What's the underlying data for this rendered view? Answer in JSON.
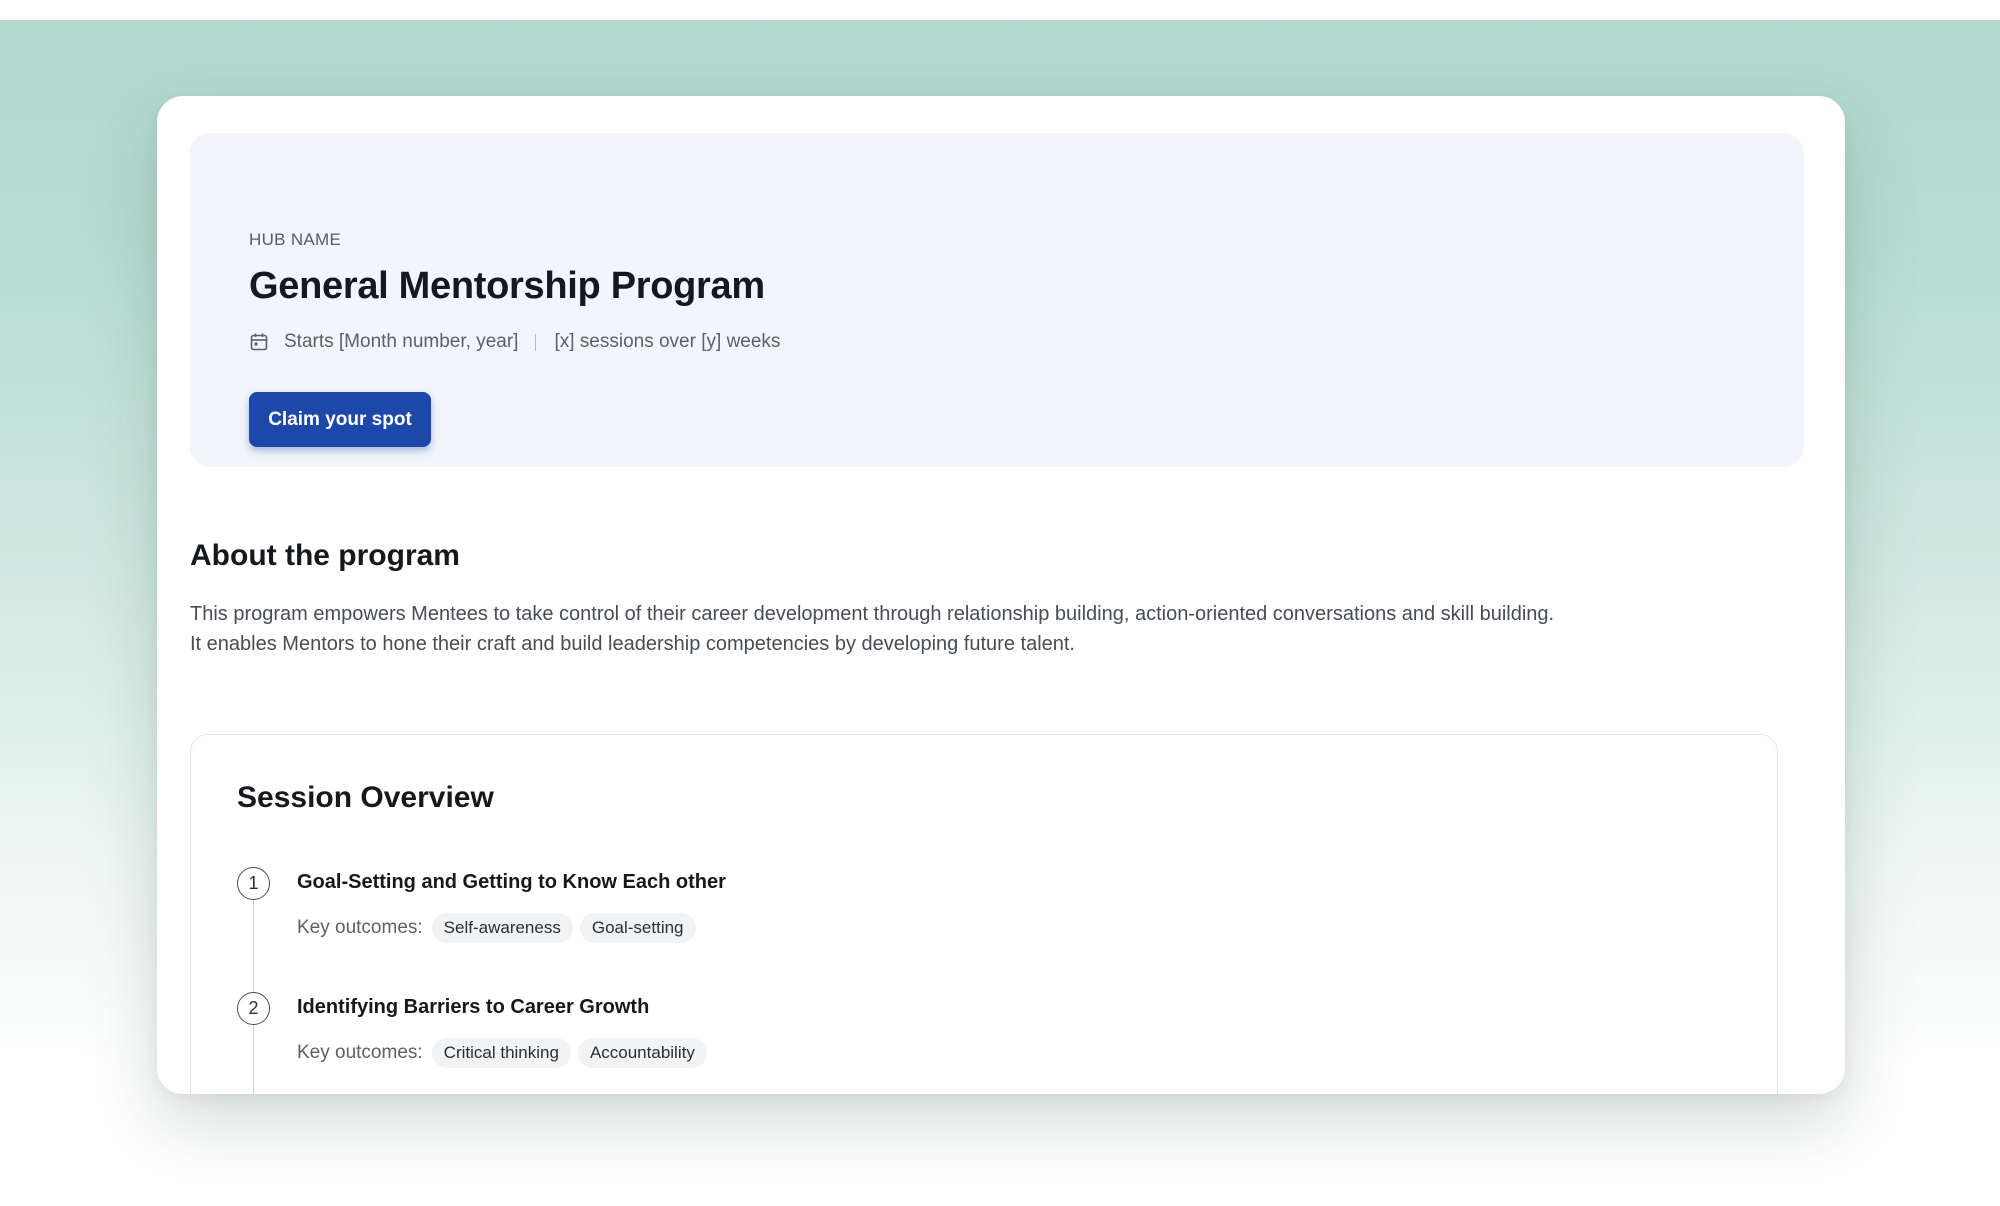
{
  "hub": {
    "label": "HUB NAME",
    "title": "General Mentorship Program",
    "start": "Starts [Month number, year]",
    "sessions_info": "[x] sessions over [y] weeks",
    "cta": "Claim your spot"
  },
  "about": {
    "title": "About the program",
    "text": "This program empowers Mentees to take control of their career development through relationship building, action-oriented conversations and skill building. It enables Mentors to hone their craft and build leadership competencies by developing future talent."
  },
  "overview": {
    "title": "Session Overview",
    "outcomes_label": "Key outcomes:",
    "sessions": [
      {
        "number": "1",
        "title": "Goal-Setting and Getting to Know Each other",
        "outcomes": [
          "Self-awareness",
          "Goal-setting"
        ]
      },
      {
        "number": "2",
        "title": "Identifying Barriers to Career Growth",
        "outcomes": [
          "Critical thinking",
          "Accountability"
        ]
      }
    ]
  },
  "colors": {
    "primary_button": "#1d47a8",
    "hero_background": "#f2f6fa",
    "page_background_top": "#b1d9ce"
  },
  "icons": {
    "date": "calendar-icon"
  }
}
